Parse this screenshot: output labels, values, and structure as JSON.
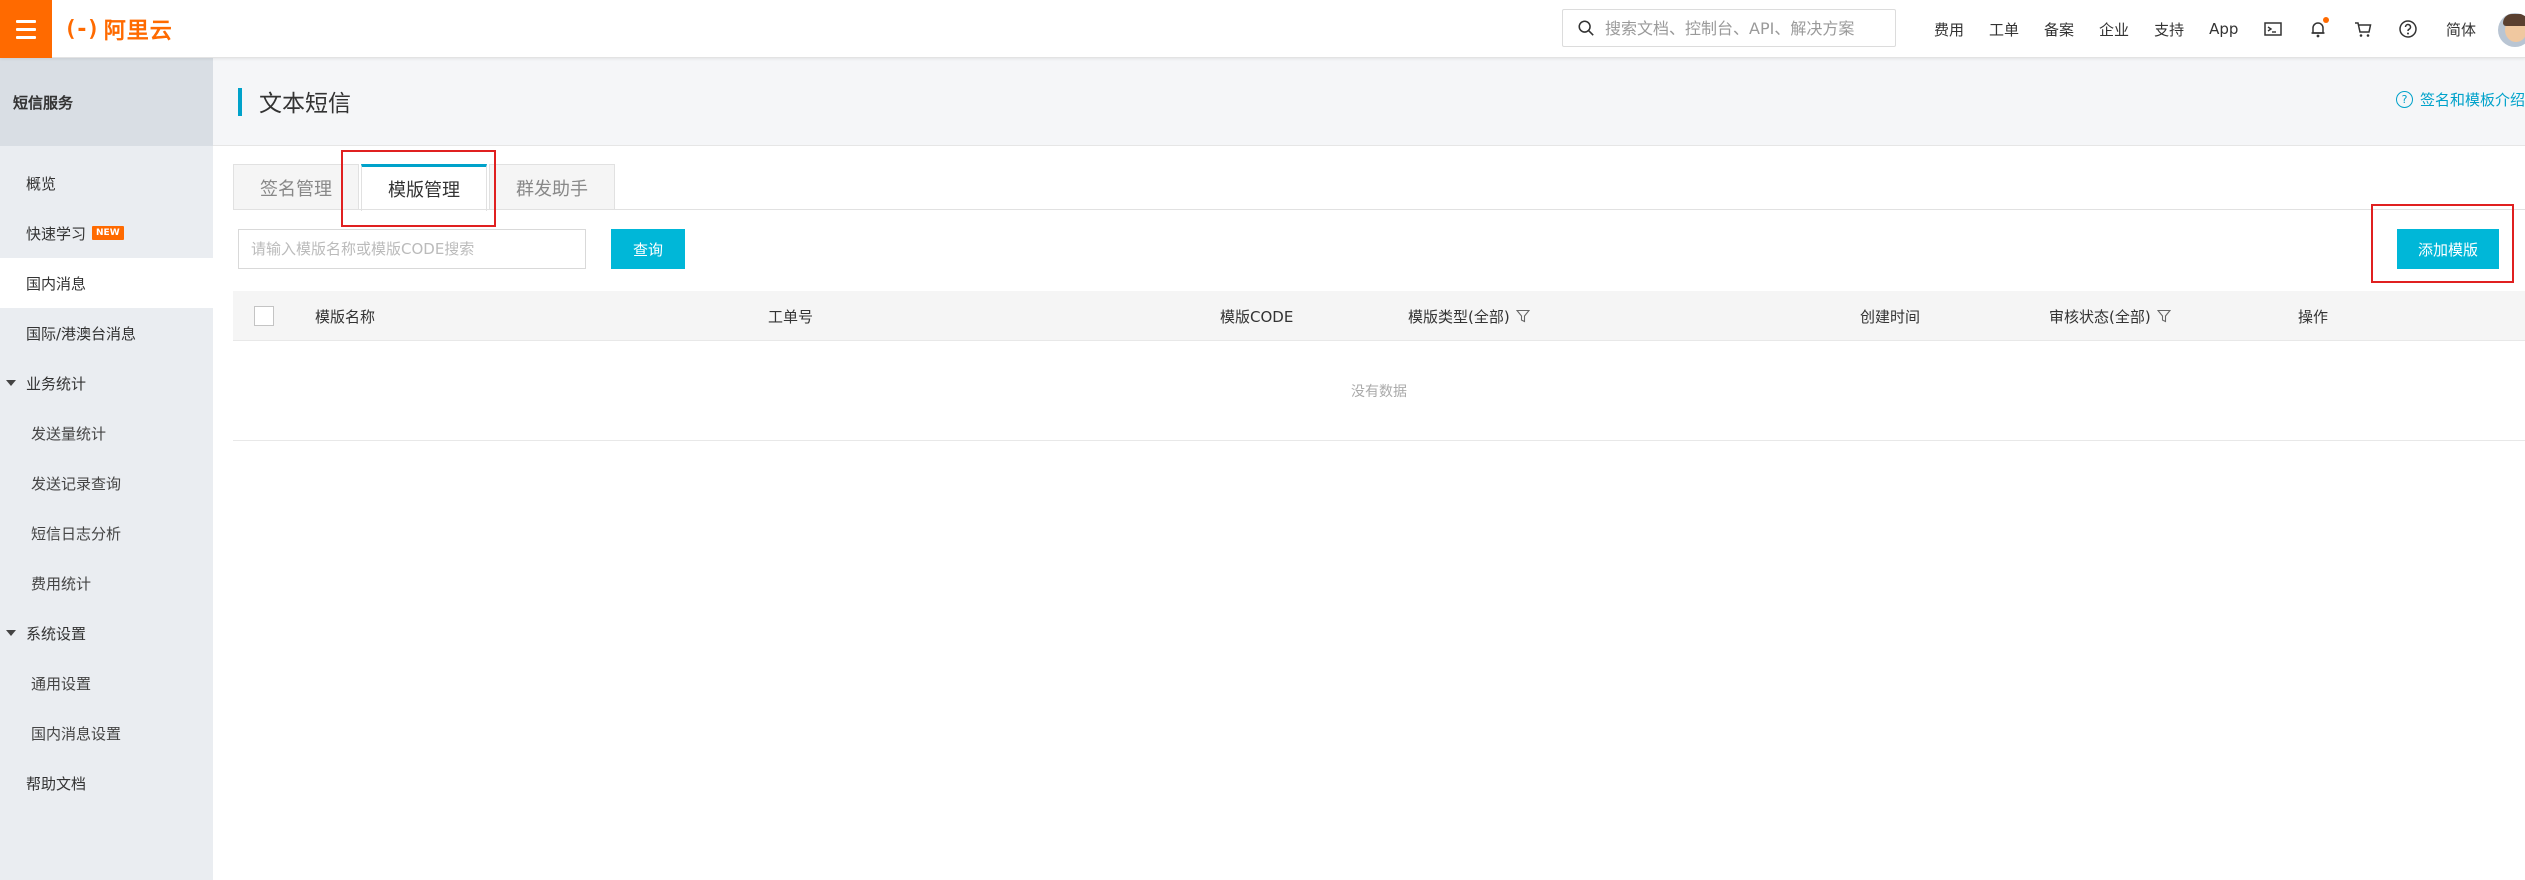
{
  "topbar": {
    "logo_mark": "(-)",
    "logo_text": "阿里云",
    "search_placeholder": "搜索文档、控制台、API、解决方案",
    "nav_links": [
      "费用",
      "工单",
      "备案",
      "企业",
      "支持",
      "App"
    ],
    "language": "简体"
  },
  "sidebar": {
    "header": "短信服务",
    "overview": "概览",
    "quick_learn": "快速学习",
    "quick_learn_badge": "NEW",
    "domestic": "国内消息",
    "intl": "国际/港澳台消息",
    "stats_group": "业务统计",
    "send_volume": "发送量统计",
    "send_record": "发送记录查询",
    "log_analysis": "短信日志分析",
    "fee_stats": "费用统计",
    "settings_group": "系统设置",
    "general_settings": "通用设置",
    "domestic_settings": "国内消息设置",
    "help_docs": "帮助文档"
  },
  "main": {
    "title": "文本短信",
    "help_link": "签名和模板介绍",
    "tabs": [
      "签名管理",
      "模版管理",
      "群发助手"
    ],
    "active_tab": "模版管理",
    "search_placeholder": "请输入模版名称或模版CODE搜索",
    "query_button": "查询",
    "add_button": "添加模版",
    "columns": [
      "模版名称",
      "工单号",
      "模版CODE",
      "模版类型(全部)",
      "创建时间",
      "审核状态(全部)",
      "操作"
    ],
    "empty_text": "没有数据"
  },
  "colors": {
    "brand_orange": "#ff6a00",
    "accent_cyan": "#00b7d8",
    "highlight_red": "#e02020"
  }
}
